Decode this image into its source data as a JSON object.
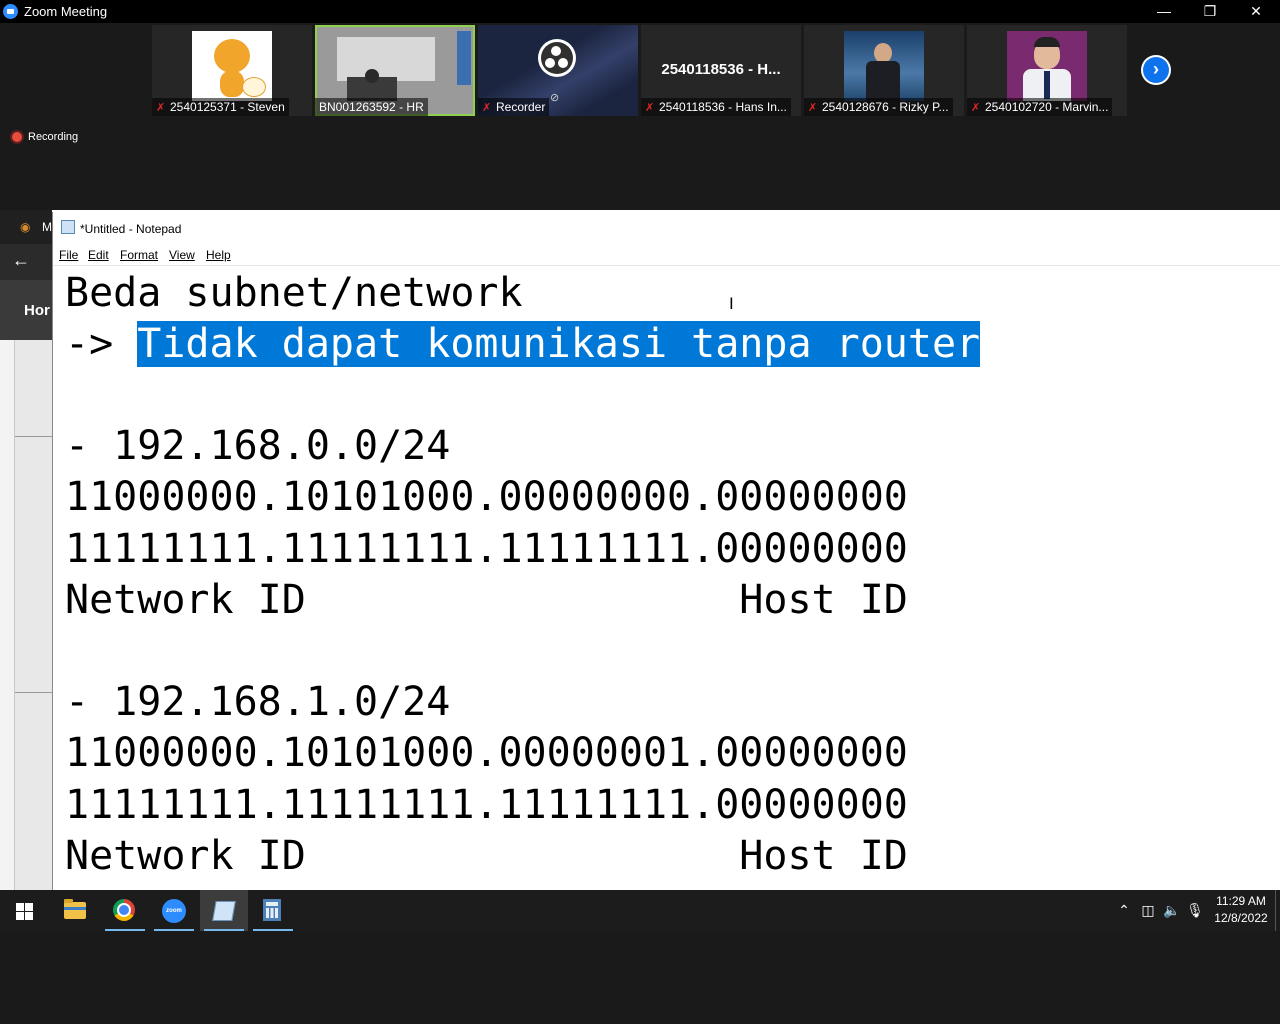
{
  "zoom": {
    "window_title": "Zoom Meeting",
    "recording_label": "Recording",
    "participants": [
      {
        "caption": "2540125371 - Steven",
        "muted": true
      },
      {
        "caption": "BN001263592 - HR",
        "muted": false
      },
      {
        "caption": "Recorder",
        "muted": true
      },
      {
        "caption": "2540118536 - Hans In...",
        "muted": true,
        "display_name": "2540118536 - H..."
      },
      {
        "caption": "2540128676 - Rizky P...",
        "muted": true
      },
      {
        "caption": "2540102720 - Marvin...",
        "muted": true
      }
    ],
    "next_icon": "chevron-right-icon"
  },
  "background_app": {
    "tab_text": "M",
    "nav_text": "Hor"
  },
  "notepad": {
    "title": "*Untitled - Notepad",
    "menu": {
      "file": "File",
      "edit": "Edit",
      "format": "Format",
      "view": "View",
      "help": "Help"
    },
    "lines": {
      "l1": "Beda subnet/network",
      "l2_prefix": "-> ",
      "l2_selected": "Tidak dapat komunikasi tanpa router",
      "l4": "- 192.168.0.0/24",
      "l5": "11000000.10101000.00000000.00000000",
      "l6": "11111111.11111111.11111111.00000000",
      "l7": "Network ID                  Host ID",
      "l9": "- 192.168.1.0/24",
      "l10": "11000000.10101000.00000001.00000000",
      "l11": "11111111.11111111.11111111.00000000",
      "l12": "Network ID                  Host ID"
    },
    "selection_color": "#0078d7"
  },
  "taskbar": {
    "apps": [
      "start-icon",
      "file-explorer-icon",
      "chrome-icon",
      "zoom-icon",
      "notepad-icon",
      "calculator-icon"
    ],
    "zoom_icon_text": "zoom",
    "time": "11:29 AM",
    "date": "12/8/2022"
  }
}
